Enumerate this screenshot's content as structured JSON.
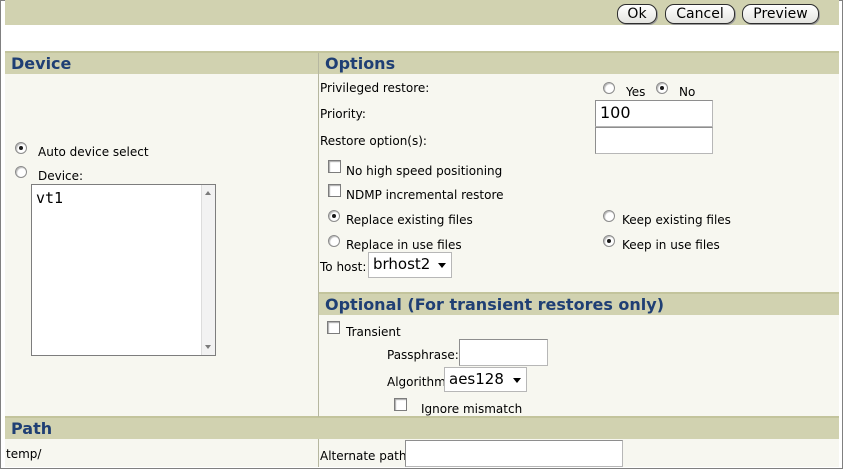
{
  "toolbar": {
    "ok_label": "Ok",
    "cancel_label": "Cancel",
    "preview_label": "Preview"
  },
  "device": {
    "heading": "Device",
    "auto_label": "Auto device select",
    "device_label": "Device:",
    "selected": "auto",
    "list_items": [
      "vt1"
    ]
  },
  "options": {
    "heading": "Options",
    "privileged_label": "Privileged restore:",
    "yes_label": "Yes",
    "no_label": "No",
    "privileged_value": "No",
    "priority_label": "Priority:",
    "priority_value": "100",
    "restore_options_label": "Restore option(s):",
    "restore_options_value": "",
    "no_high_speed_label": "No high speed positioning",
    "ndmp_label": "NDMP incremental restore",
    "replace_existing_label": "Replace existing files",
    "keep_existing_label": "Keep existing files",
    "replace_in_use_label": "Replace in use files",
    "keep_in_use_label": "Keep in use files",
    "to_host_label": "To host:",
    "to_host_value": "brhost2"
  },
  "optional": {
    "heading": "Optional (For transient restores only)",
    "transient_label": "Transient",
    "passphrase_label": "Passphrase:",
    "passphrase_value": "",
    "algorithm_label": "Algorithm",
    "algorithm_value": "aes128",
    "ignore_mismatch_label": "Ignore mismatch"
  },
  "path": {
    "heading": "Path",
    "value": "temp/",
    "alternate_label": "Alternate path:",
    "alternate_value": ""
  },
  "colors": {
    "header_bg": "#d1d2b0",
    "header_text": "#1f3f74",
    "panel_bg": "#f7f7f0"
  }
}
